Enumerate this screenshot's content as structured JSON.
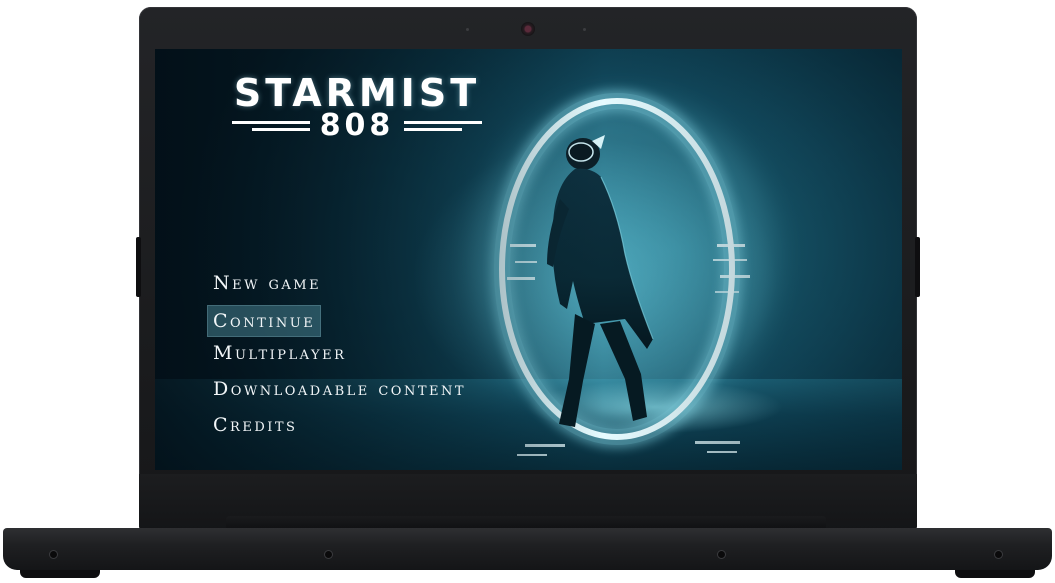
{
  "game": {
    "logo_title": "STARMIST",
    "logo_subtitle": "808"
  },
  "menu": {
    "items": [
      {
        "label": "New game",
        "selected": false
      },
      {
        "label": "Continue",
        "selected": true
      },
      {
        "label": "Multiplayer",
        "selected": false
      },
      {
        "label": "Downloadable content",
        "selected": false
      },
      {
        "label": "Credits",
        "selected": false
      }
    ]
  },
  "colors": {
    "screen_teal": "#1f6f85",
    "portal_glow": "#bff4ff",
    "bezel": "#1b1c1e",
    "menu_highlight": "#467d8c"
  },
  "icons": {
    "camera": "webcam-icon"
  }
}
